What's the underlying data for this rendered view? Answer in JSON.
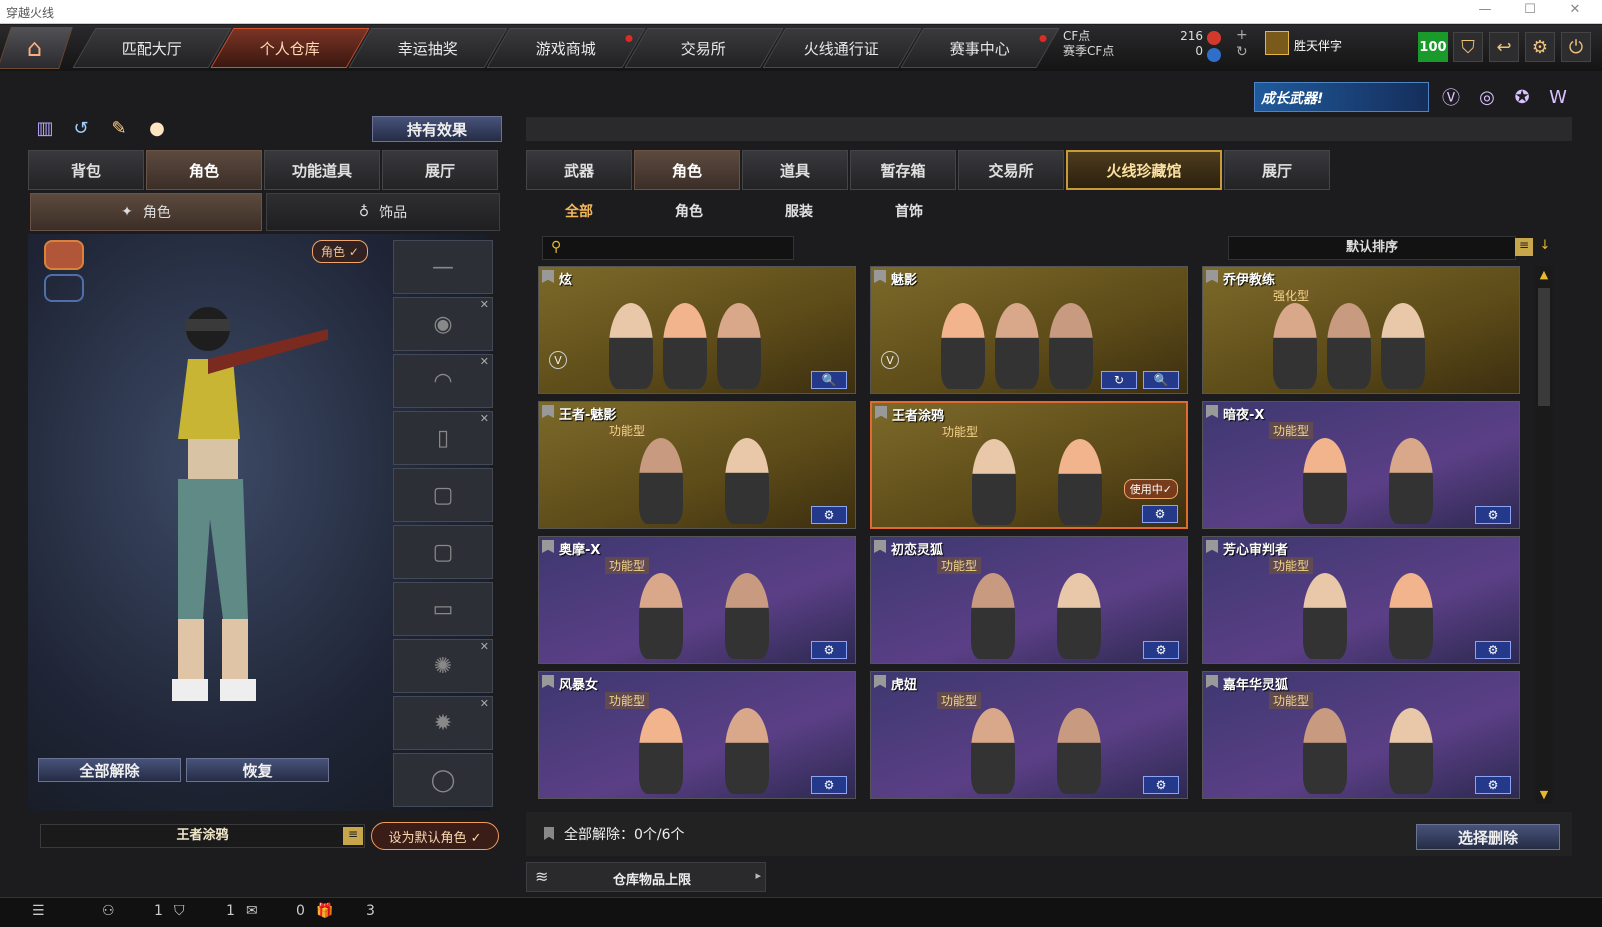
{
  "window": {
    "title": "穿越火线",
    "min": "—",
    "max": "☐",
    "close": "✕"
  },
  "nav": {
    "home": "⌂",
    "tabs": [
      {
        "label": "匹配大厅",
        "active": false,
        "dot": false
      },
      {
        "label": "个人仓库",
        "active": true,
        "dot": false
      },
      {
        "label": "幸运抽奖",
        "active": false,
        "dot": false
      },
      {
        "label": "游戏商城",
        "active": false,
        "dot": true
      },
      {
        "label": "交易所",
        "active": false,
        "dot": false
      },
      {
        "label": "火线通行证",
        "active": false,
        "dot": false
      },
      {
        "label": "赛事中心",
        "active": false,
        "dot": true
      }
    ],
    "cf_label": "CF点",
    "season_label": "赛季CF点",
    "cf_value": "216",
    "season_value": "0",
    "username": "胜天伴字",
    "vip": "100"
  },
  "banner": {
    "text": "成长武器!"
  },
  "left": {
    "effect_btn": "持有效果",
    "tabs": [
      "背包",
      "角色",
      "功能道具",
      "展厅"
    ],
    "active_tab": "角色",
    "subtabs": [
      "角色",
      "饰品"
    ],
    "role_badge": "角色 ✓",
    "unequip_all": "全部解除",
    "restore": "恢复",
    "current_role": "王者涂鸦",
    "set_default": "设为默认角色 ✓"
  },
  "right": {
    "tabs": [
      "武器",
      "角色",
      "道具",
      "暂存箱",
      "交易所",
      "火线珍藏馆",
      "展厅"
    ],
    "active_tab": "角色",
    "gold_tab": "火线珍藏馆",
    "filters": [
      "全部",
      "角色",
      "服装",
      "首饰"
    ],
    "active_filter": "全部",
    "search_placeholder": "",
    "sort_label": "默认排序",
    "cards": [
      {
        "name": "炫",
        "type": "",
        "theme": "gold",
        "v": true,
        "ctls": [
          "🔍"
        ],
        "inuse": ""
      },
      {
        "name": "魅影",
        "type": "",
        "theme": "gold",
        "v": true,
        "ctls": [
          "↻",
          "🔍"
        ],
        "inuse": ""
      },
      {
        "name": "乔伊教练",
        "type": "强化型",
        "theme": "gold",
        "v": false,
        "ctls": [],
        "inuse": ""
      },
      {
        "name": "王者-魅影",
        "type": "功能型",
        "theme": "gold",
        "v": false,
        "ctls": [
          "⚙"
        ],
        "inuse": ""
      },
      {
        "name": "王者涂鸦",
        "type": "功能型",
        "theme": "gold",
        "v": false,
        "ctls": [
          "⚙"
        ],
        "inuse": "使用中✓",
        "selected": true
      },
      {
        "name": "暗夜-X",
        "type": "功能型",
        "theme": "purple",
        "v": false,
        "ctls": [
          "⚙"
        ],
        "inuse": ""
      },
      {
        "name": "奥摩-X",
        "type": "功能型",
        "theme": "purple",
        "v": false,
        "ctls": [
          "⚙"
        ],
        "inuse": ""
      },
      {
        "name": "初恋灵狐",
        "type": "功能型",
        "theme": "purple",
        "v": false,
        "ctls": [
          "⚙"
        ],
        "inuse": ""
      },
      {
        "name": "芳心审判者",
        "type": "功能型",
        "theme": "purple",
        "v": false,
        "ctls": [
          "⚙"
        ],
        "inuse": ""
      },
      {
        "name": "风暴女",
        "type": "功能型",
        "theme": "purple",
        "v": false,
        "ctls": [
          "⚙"
        ],
        "inuse": ""
      },
      {
        "name": "虎妞",
        "type": "功能型",
        "theme": "purple",
        "v": false,
        "ctls": [
          "⚙"
        ],
        "inuse": ""
      },
      {
        "name": "嘉年华灵狐",
        "type": "功能型",
        "theme": "purple",
        "v": false,
        "ctls": [
          "⚙"
        ],
        "inuse": ""
      }
    ],
    "unequip_count": "全部解除：0个/6个",
    "delete_btn": "选择删除",
    "storage_limit": "仓库物品上限"
  },
  "status": {
    "friends": "1",
    "clan": "1",
    "chat": "0",
    "gift": "3"
  },
  "colors": {
    "accent": "#d2522e",
    "gold": "#c99a3a",
    "blue": "#24398a"
  }
}
